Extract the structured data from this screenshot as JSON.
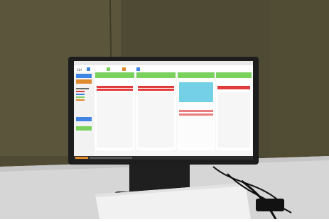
{
  "photo": {
    "description_tag": "monitor-showing-spreadsheet-app",
    "colors": {
      "wall": "#4f4a33",
      "wall_light": "#5e5940",
      "desk": "#d7d7d7",
      "bezel": "#1d1d1d",
      "keyboard": "#f1f1f1",
      "screen_bg": "#f7f7f7",
      "accent_green": "#7bd15d",
      "accent_blue": "#3f86e4",
      "accent_red": "#e23b3b",
      "accent_cyan": "#74d0e6"
    }
  },
  "ui": {
    "toolbar": {
      "left_label": "Ctrl",
      "tool_1": "",
      "tool_2": "",
      "tool_3": ""
    },
    "sidebar": {
      "btn_1": "",
      "btn_2": ""
    },
    "status": {
      "text": ""
    }
  },
  "panels": [
    {
      "header": "",
      "accent": "#7bd15d"
    },
    {
      "header": "",
      "accent": "#7bd15d"
    },
    {
      "header": "",
      "accent": "#7bd15d"
    },
    {
      "header": "",
      "accent": "#7bd15d"
    }
  ]
}
